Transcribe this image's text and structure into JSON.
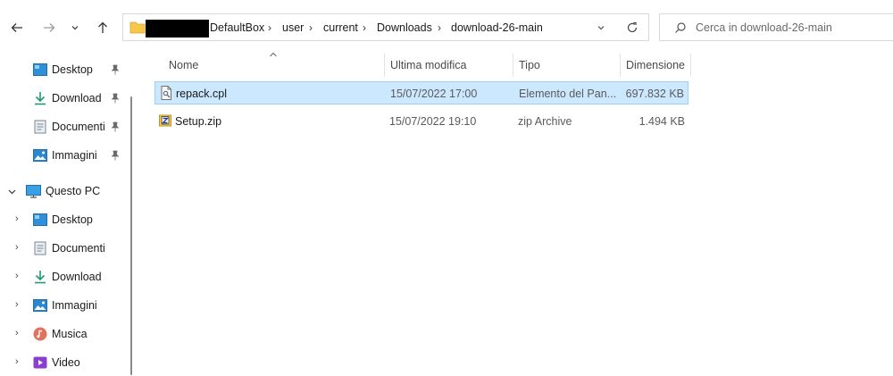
{
  "breadcrumb": [
    "DefaultBox",
    "user",
    "current",
    "Downloads",
    "download-26-main"
  ],
  "search": {
    "placeholder": "Cerca in download-26-main"
  },
  "sidebar": {
    "quick_access": [
      {
        "label": "Desktop",
        "icon": "desktop-icon"
      },
      {
        "label": "Download",
        "icon": "download-icon"
      },
      {
        "label": "Documenti",
        "icon": "document-icon"
      },
      {
        "label": "Immagini",
        "icon": "pictures-icon"
      }
    ],
    "this_pc": {
      "label": "Questo PC",
      "children": [
        {
          "label": "Desktop",
          "icon": "desktop-icon"
        },
        {
          "label": "Documenti",
          "icon": "document-icon"
        },
        {
          "label": "Download",
          "icon": "download-icon"
        },
        {
          "label": "Immagini",
          "icon": "pictures-icon"
        },
        {
          "label": "Musica",
          "icon": "music-icon"
        },
        {
          "label": "Video",
          "icon": "video-icon"
        }
      ]
    }
  },
  "columns": {
    "name": "Nome",
    "modified": "Ultima modifica",
    "type": "Tipo",
    "size": "Dimensione"
  },
  "files": [
    {
      "name": "repack.cpl",
      "modified": "15/07/2022 17:00",
      "type": "Elemento del Pan...",
      "size": "697.832 KB",
      "selected": true,
      "icon": "cpl-file-icon"
    },
    {
      "name": "Setup.zip",
      "modified": "15/07/2022 19:10",
      "type": "zip Archive",
      "size": "1.494 KB",
      "selected": false,
      "icon": "zip-file-icon"
    }
  ],
  "colors": {
    "selection": "#cce8ff",
    "selection_border": "#99d1ff",
    "folder": "#f8c64a"
  }
}
